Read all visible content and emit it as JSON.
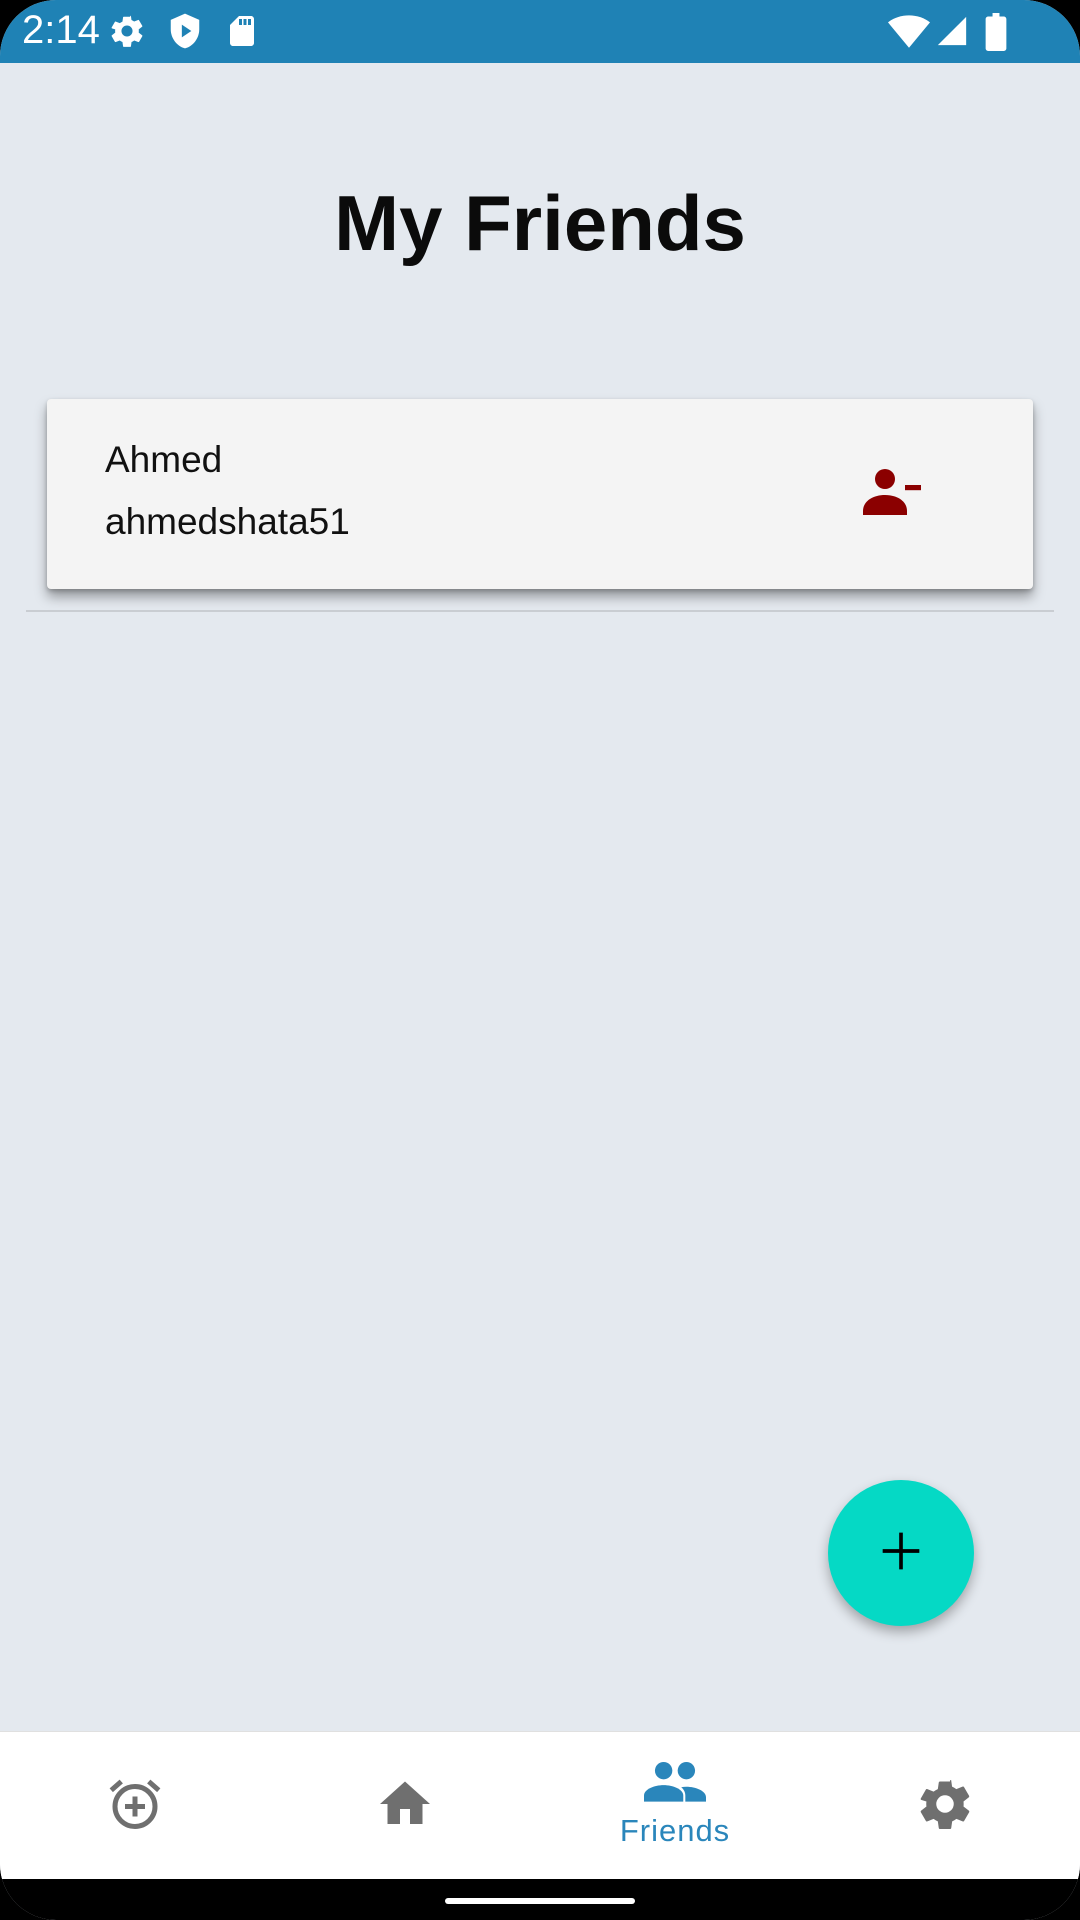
{
  "status_bar": {
    "time": "2:14",
    "icons_left": [
      "gear-icon",
      "shield-play-icon",
      "sd-card-icon"
    ],
    "icons_right": [
      "wifi-icon",
      "signal-icon",
      "battery-icon"
    ]
  },
  "page": {
    "title": "My Friends"
  },
  "friends": [
    {
      "name": "Ahmed",
      "username": "ahmedshata51",
      "action_icon": "person-remove-icon"
    }
  ],
  "fab": {
    "icon": "plus-icon"
  },
  "bottom_nav": {
    "items": [
      {
        "icon": "alarm-add-icon",
        "label": ""
      },
      {
        "icon": "home-icon",
        "label": ""
      },
      {
        "icon": "people-icon",
        "label": "Friends",
        "active": true
      },
      {
        "icon": "settings-icon",
        "label": ""
      }
    ]
  },
  "colors": {
    "status_bar": "#1f82b5",
    "background": "#e4e9ef",
    "remove_icon": "#8b0000",
    "fab": "#05d9c5",
    "nav_active": "#2a86bb",
    "nav_inactive": "#6f6f6f"
  }
}
